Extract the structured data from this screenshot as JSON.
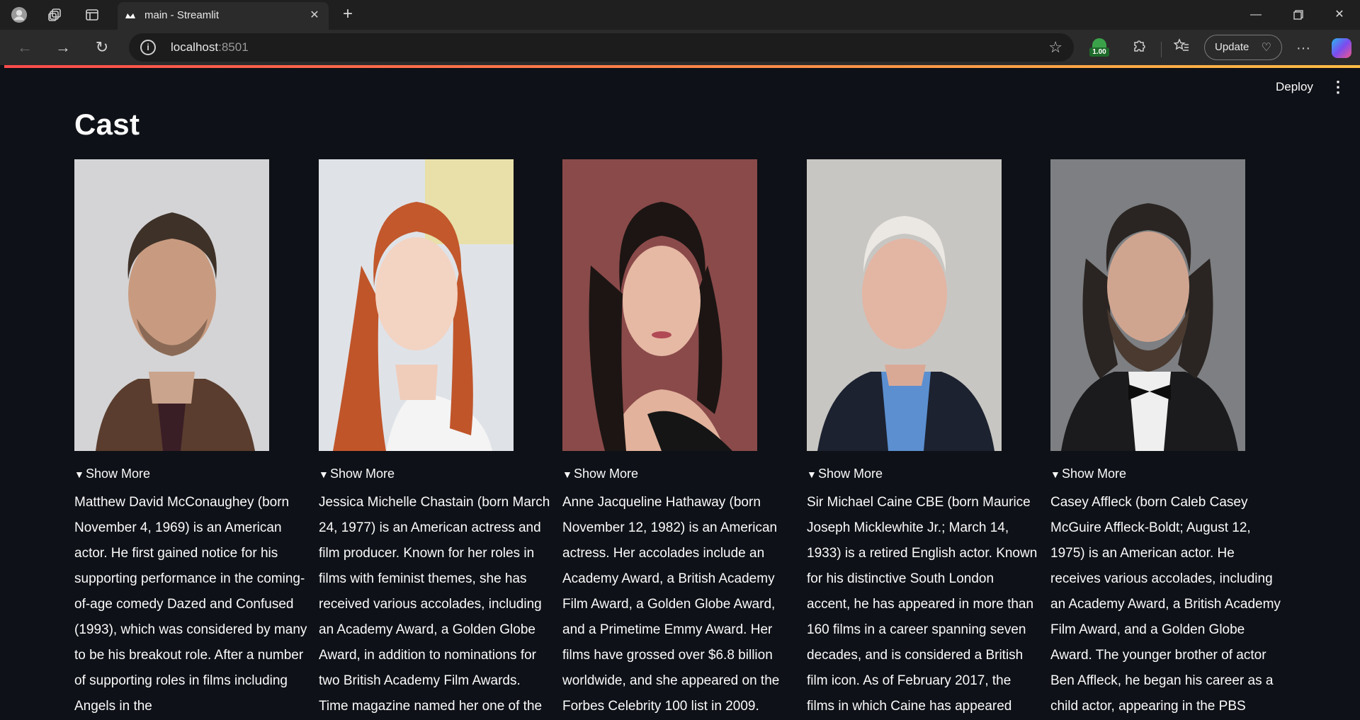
{
  "browser": {
    "tab_title": "main - Streamlit",
    "url_host": "localhost",
    "url_port": ":8501",
    "extension_badge": "1.00",
    "update_label": "Update"
  },
  "app": {
    "deploy_label": "Deploy",
    "title": "Cast",
    "expander_label": "Show More",
    "cast": [
      {
        "name": "Matthew McConaughey",
        "bio": "Matthew David McConaughey (born November 4, 1969) is an American actor. He first gained notice for his supporting performance in the coming-of-age comedy Dazed and Confused (1993), which was considered by many to be his breakout role. After a number of supporting roles in films including Angels in the"
      },
      {
        "name": "Jessica Chastain",
        "bio": "Jessica Michelle Chastain (born March 24, 1977) is an American actress and film producer. Known for her roles in films with feminist themes, she has received various accolades, including an Academy Award, a Golden Globe Award, in addition to nominations for two British Academy Film Awards. Time magazine named her one of the"
      },
      {
        "name": "Anne Hathaway",
        "bio": "Anne Jacqueline Hathaway (born November 12, 1982) is an American actress. Her accolades include an Academy Award, a British Academy Film Award, a Golden Globe Award, and a Primetime Emmy Award. Her films have grossed over $6.8 billion worldwide, and she appeared on the Forbes Celebrity 100 list in 2009."
      },
      {
        "name": "Michael Caine",
        "bio": "Sir Michael Caine CBE (born Maurice Joseph Micklewhite Jr.; March 14, 1933) is a retired English actor. Known for his distinctive South London accent, he has appeared in more than 160 films in a career spanning seven decades, and is considered a British film icon. As of February 2017, the films in which Caine has appeared"
      },
      {
        "name": "Casey Affleck",
        "bio": "Casey Affleck (born Caleb Casey McGuire Affleck-Boldt; August 12, 1975) is an American actor. He receives various accolades, including an Academy Award, a British Academy Film Award, and a Golden Globe Award. The younger brother of actor Ben Affleck, he began his career as a child actor, appearing in the PBS"
      }
    ]
  }
}
